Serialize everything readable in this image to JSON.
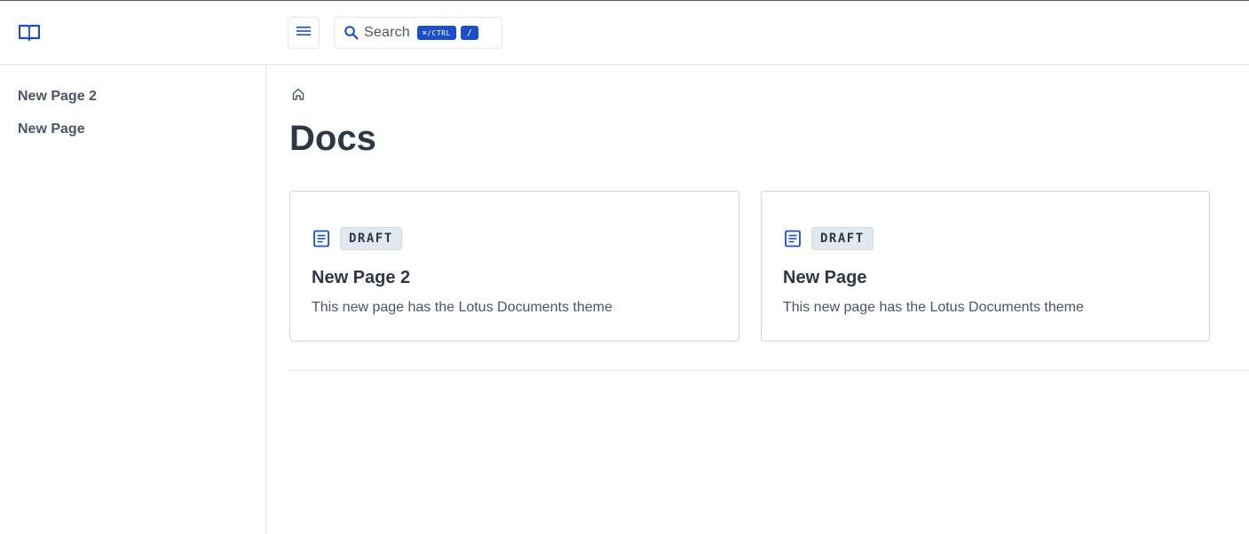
{
  "header": {
    "logo_icon": "open-book-icon",
    "menu_icon": "hamburger-menu-icon",
    "search": {
      "label": "Search",
      "icon": "search-icon",
      "shortcut_key": "⌘/CTRL",
      "shortcut_slash": "/"
    }
  },
  "sidebar": {
    "items": [
      {
        "label": "New Page 2"
      },
      {
        "label": "New Page"
      }
    ]
  },
  "main": {
    "breadcrumb": {
      "home_icon": "home-icon"
    },
    "title": "Docs",
    "cards": [
      {
        "icon": "document-icon",
        "badge": "DRAFT",
        "title": "New Page 2",
        "description": "This new page has the Lotus Documents theme"
      },
      {
        "icon": "document-icon",
        "badge": "DRAFT",
        "title": "New Page",
        "description": "This new page has the Lotus Documents theme"
      }
    ]
  },
  "colors": {
    "accent": "#1a4fc7",
    "text": "#2d3748",
    "muted": "#4a5568",
    "border": "#e2e8f0",
    "badge_bg": "#e2e8f0"
  }
}
